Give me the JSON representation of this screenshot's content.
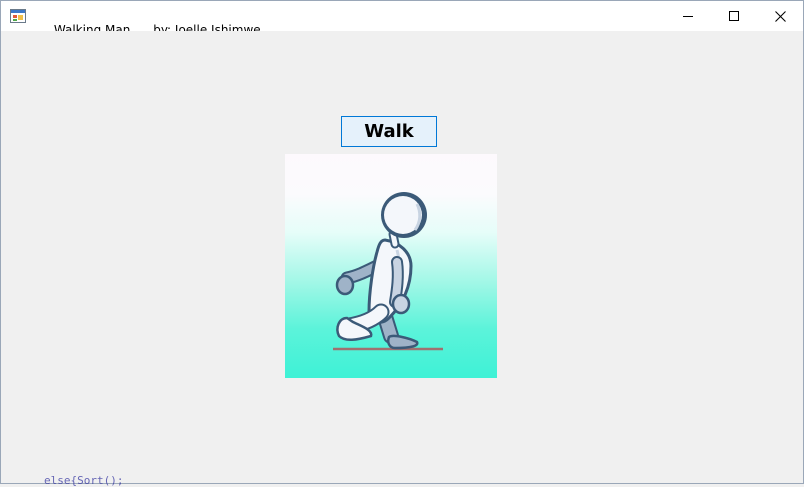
{
  "window": {
    "title": "Walking Man",
    "subtitle": "by: Joelle Ishimwe",
    "app_icon": "windows-form-icon",
    "controls": {
      "minimize_icon": "minimize-icon",
      "maximize_icon": "maximize-icon",
      "close_icon": "close-icon"
    }
  },
  "main": {
    "walk_button_label": "Walk",
    "picture": {
      "content": "walking-man-figure",
      "accent_color": "#3ef2d6",
      "ground_color": "#a07070"
    }
  },
  "background_bleed": "else{Sort();"
}
